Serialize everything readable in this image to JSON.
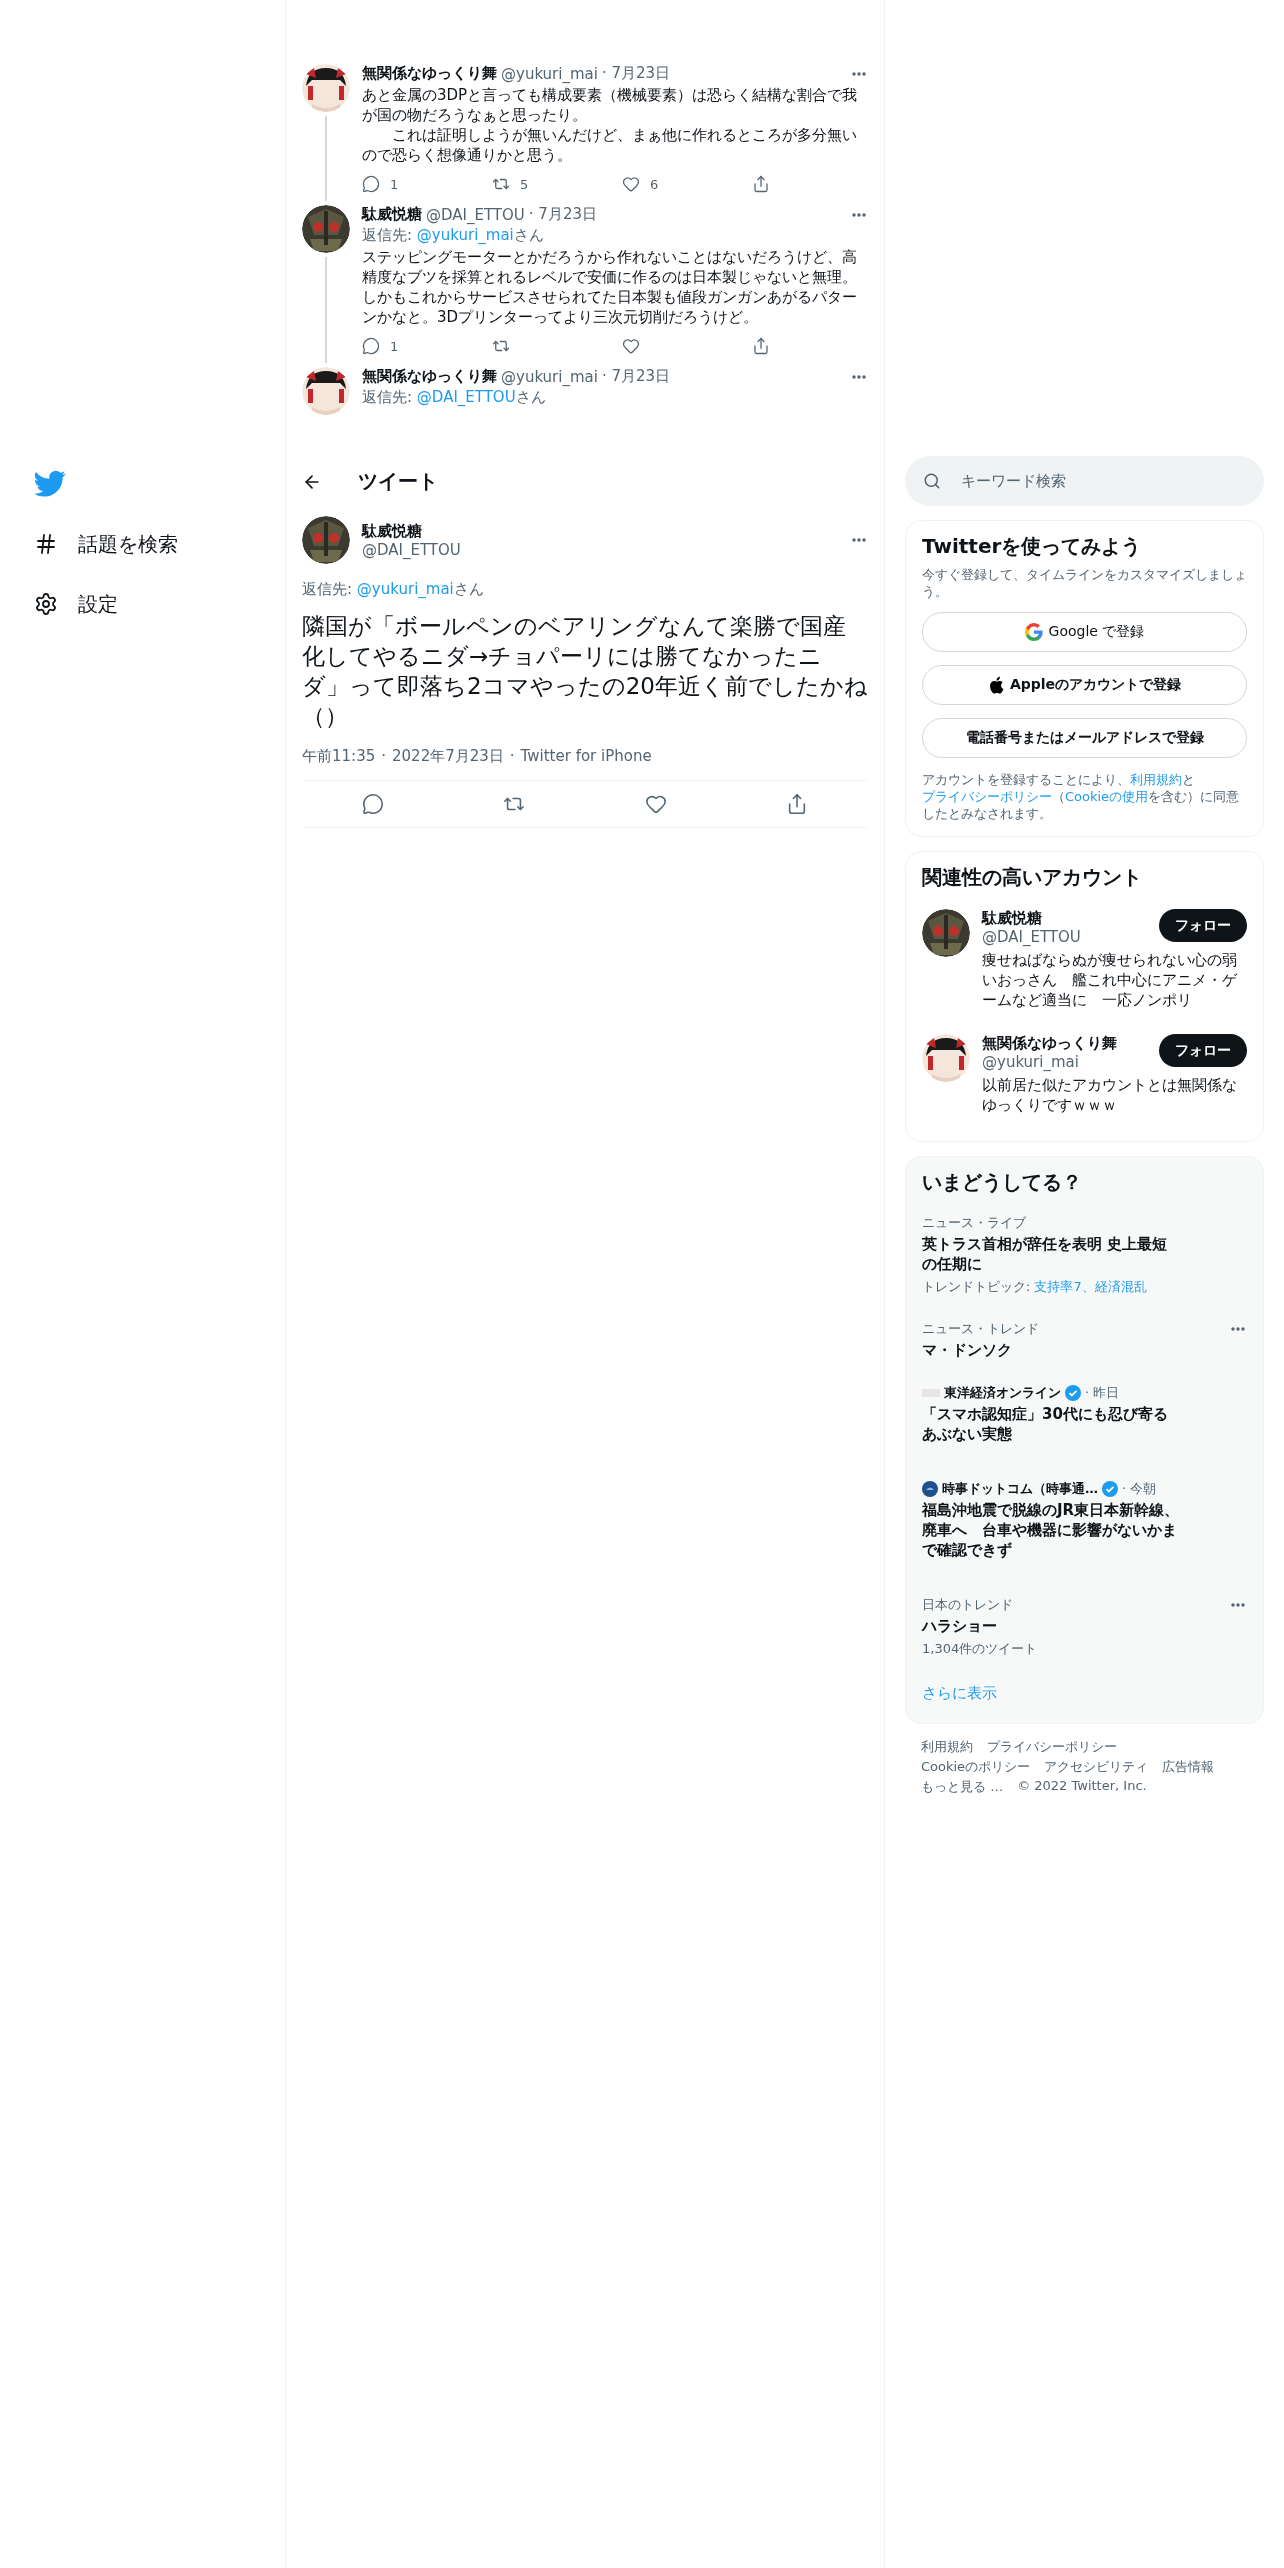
{
  "sidebar": {
    "items": [
      {
        "kind": "logo"
      },
      {
        "kind": "explore",
        "label": "話題を検索"
      },
      {
        "kind": "settings",
        "label": "設定"
      }
    ]
  },
  "thread": [
    {
      "avatar": {
        "kind": "yukkuri"
      },
      "name": "無関係なゆっくり舞",
      "handle": "@yukuri_mai",
      "date": "· 7月23日",
      "paragraphs": [
        "あと金属の3DPと言っても構成要素（機械要素）は恐らく結構な割合で我が国の物だろうなぁと思ったり。",
        "これは証明しようが無いんだけど、まぁ他に作れるところが多分無いので恐らく想像通りかと思う。"
      ],
      "actions": [
        {
          "kind": "reply",
          "count": "1"
        },
        {
          "kind": "retweet",
          "count": "5"
        },
        {
          "kind": "like",
          "count": "6"
        },
        {
          "kind": "share"
        }
      ]
    },
    {
      "avatar": {
        "kind": "mecha"
      },
      "name": "駄威悦糖",
      "handle": "@DAI_ETTOU",
      "date": "· 7月23日",
      "reply_to": {
        "prefix": "返信先:",
        "handle": "@yukuri_mai",
        "suffix": "さん"
      },
      "paragraphs": [
        "ステッピングモーターとかだろうから作れないことはないだろうけど、高精度なブツを採算とれるレベルで安価に作るのは日本製じゃないと無理。しかもこれからサービスさせられてた日本製も値段ガンガンあがるパターンかなと。3Dプリンターってより三次元切削だろうけど。"
      ],
      "actions": [
        {
          "kind": "reply",
          "count": "1"
        },
        {
          "kind": "retweet"
        },
        {
          "kind": "like"
        },
        {
          "kind": "share"
        }
      ]
    },
    {
      "avatar": {
        "kind": "yukkuri"
      },
      "name": "無関係なゆっくり舞",
      "handle": "@yukuri_mai",
      "date": "· 7月23日",
      "reply_to": {
        "prefix": "返信先:",
        "handle": "@DAI_ETTOU",
        "suffix": "さん"
      }
    }
  ],
  "header": {
    "title": "ツイート"
  },
  "main_tweet": {
    "avatar": {
      "kind": "mecha"
    },
    "name": "駄威悦糖",
    "handle": "@DAI_ETTOU",
    "reply_to": {
      "prefix": "返信先:",
      "handle": "@yukuri_mai",
      "suffix": "さん"
    },
    "text": "隣国が「ボールペンのベアリングなんて楽勝で国産化してやるニダ→チョパーリには勝てなかったニダ」って即落ち2コマやったの20年近く前でしたかね（）",
    "meta": [
      "午前11:35",
      "·",
      "2022年7月23日",
      "·",
      "Twitter for iPhone"
    ],
    "actions": [
      {
        "kind": "reply"
      },
      {
        "kind": "retweet"
      },
      {
        "kind": "like"
      },
      {
        "kind": "share"
      }
    ]
  },
  "search": {
    "placeholder": "キーワード検索"
  },
  "signup": {
    "title": "Twitterを使ってみよう",
    "subtitle": "今すぐ登録して、タイムラインをカスタマイズしましょう。",
    "buttons": [
      {
        "kind": "google",
        "label": "Google で登録"
      },
      {
        "kind": "apple",
        "label": "Appleのアカウントで登録"
      },
      {
        "kind": "plain",
        "label": "電話番号またはメールアドレスで登録"
      }
    ],
    "legal": [
      {
        "text": "アカウントを登録することにより、",
        "link": false
      },
      {
        "text": "利用規約",
        "link": true
      },
      {
        "text": "と",
        "link": false
      },
      {
        "text": "プライバシーポリシー",
        "link": true
      },
      {
        "text": "（",
        "link": false
      },
      {
        "text": "Cookieの使用",
        "link": true
      },
      {
        "text": "を含む）に同意したとみなされます。",
        "link": false
      }
    ]
  },
  "who_to_follow": {
    "title": "関連性の高いアカウント",
    "accounts": [
      {
        "avatar": {
          "kind": "mecha"
        },
        "name": "駄威悦糖",
        "handle": "@DAI_ETTOU",
        "bio": "痩せねばならぬが痩せられない心の弱いおっさん　艦これ中心にアニメ・ゲームなど適当に　一応ノンポリ",
        "button": "フォロー"
      },
      {
        "avatar": {
          "kind": "yukkuri"
        },
        "name": "無関係なゆっくり舞",
        "handle": "@yukuri_mai",
        "bio": "以前居た似たアカウントとは無関係なゆっくりですｗｗｗ",
        "button": "フォロー"
      }
    ]
  },
  "trends": {
    "title": "いまどうしてる？",
    "items": [
      {
        "kind": "news",
        "context": "ニュース・ライブ",
        "title": "英トラス首相が辞任を表明 史上最短の任期に",
        "topic_prefix": "トレンドトピック:",
        "topics": "支持率7、経済混乱",
        "menu": false
      },
      {
        "kind": "trend",
        "context": "ニュース・トレンド",
        "title": "マ・ドンソク",
        "menu": true
      },
      {
        "kind": "article",
        "logo": {
          "kind": "faint"
        },
        "source": "東洋経済オンライン",
        "verified": true,
        "time": "· 昨日",
        "title": "「スマホ認知症」30代にも忍び寄るあぶない実態",
        "menu": false
      },
      {
        "kind": "article",
        "logo": {
          "kind": "round"
        },
        "source": "時事ドットコム（時事通…",
        "verified": true,
        "time": "· 今朝",
        "title": "福島沖地震で脱線のJR東日本新幹線、廃車へ　台車や機器に影響がないかまで確認できず",
        "menu": false
      },
      {
        "kind": "trend",
        "context": "日本のトレンド",
        "title": "ハラショー",
        "count": "1,304件のツイート",
        "menu": true
      }
    ],
    "more_link": "さらに表示"
  },
  "footer": [
    "利用規約",
    "プライバシーポリシー",
    "Cookieのポリシー",
    "アクセシビリティ",
    "広告情報",
    "もっと見る …",
    "© 2022 Twitter, Inc."
  ]
}
